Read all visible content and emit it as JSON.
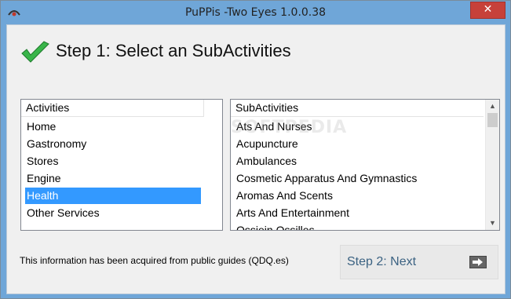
{
  "window": {
    "title": "PuPPis -Two Eyes 1.0.0.38",
    "close_glyph": "✕",
    "app_icon": "eye-app-icon"
  },
  "heading": {
    "text": "Step 1: Select an SubActivities",
    "icon": "green-check-icon"
  },
  "activities": {
    "header": "Activities",
    "items": [
      "Home",
      "Gastronomy",
      "Stores",
      "Engine",
      "Health",
      "Other Services"
    ],
    "selected": "Health"
  },
  "subactivities": {
    "header": "SubActivities",
    "items": [
      "Ats And Nurses",
      "Acupuncture",
      "Ambulances",
      "Cosmetic Apparatus And Gymnastics",
      "Aromas And Scents",
      "Arts And Entertainment"
    ],
    "partial_item": "Ossiein Ossilles"
  },
  "watermark": "SOFTPEDIA",
  "footer": {
    "info": "This information has been acquired from public guides (QDQ.es)"
  },
  "next_button": {
    "label": "Step 2: Next",
    "icon": "arrow-right-icon"
  },
  "colors": {
    "selection": "#3399ff",
    "accent_text": "#3b6282",
    "frame": "#6fa6d8"
  }
}
